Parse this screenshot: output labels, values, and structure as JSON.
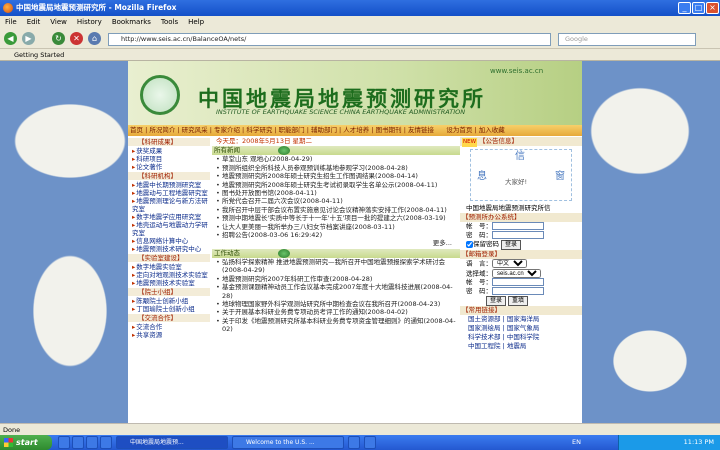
{
  "window": {
    "title": "中国地震局地震预测研究所 - Mozilla Firefox"
  },
  "menu": [
    "File",
    "Edit",
    "View",
    "History",
    "Bookmarks",
    "Tools",
    "Help"
  ],
  "toolbar": {
    "url": "http://www.seis.ac.cn/BalanceOA/nets/",
    "search_placeholder": "Google"
  },
  "bookmarks": {
    "item": "Getting Started"
  },
  "site": {
    "url_text": "www.seis.ac.cn",
    "title_cn": "中国地震局地震预测研究所",
    "title_en": "INSTITUTE OF EARTHQUAKE SCIENCE CHINA EARTHQUAKE ADMINISTRATION",
    "nav": [
      "首页",
      "所况简介",
      "研究风采",
      "专家介绍",
      "科学研究",
      "职能部门",
      "辅助部门",
      "人才培养",
      "图书期刊",
      "友情链接",
      "设为首页",
      "加入收藏"
    ],
    "date": "今天是：2008年5月13日 星期二"
  },
  "sidebar": {
    "sec1": "【科研成果】",
    "list1": [
      "获奖成果",
      "科研项目",
      "论文著作"
    ],
    "sec2": "【科研机构】",
    "list2": [
      "地震中长期预测研究室",
      "地震动与工程地震研究室",
      "地震预测理论与新方法研究室",
      "数字地震学应用研究室",
      "地壳运动与地震动力学研究室",
      "信息网络计算中心",
      "地震预测技术研究中心"
    ],
    "sec3": "【实验室建设】",
    "list3": [
      "数字地震实验室",
      "定向对地观测技术实验室",
      "地震预测技术实验室"
    ],
    "sec4": "【院士小组】",
    "list4": [
      "陈颙院士创新小组",
      "丁国瑜院士创新小组"
    ],
    "sec5": "【交流合作】",
    "list5": [
      "交流合作",
      "共享资源"
    ]
  },
  "news": {
    "header": "所有新闻",
    "items": [
      "草堂山东 观地心(2008-04-29)",
      "预测所组织全所科技人员参观预训练基地参观学习(2008-04-28)",
      "地震预测研究所2008年硕士研究生招生工作图调结果(2008-04-14)",
      "地震预测研究所2008年硕士研究生考试初录取学生名单公示(2008-04-11)",
      "图书处开放图书馆(2008-04-11)",
      "所党代会召开二届六次会议(2008-04-11)",
      "我所召开中层干部会议布置实施意见讨论会议精神落实安排工作(2008-04-11)",
      "预测中期地震长'实质中等长于十一年'十五'项目一批的提建之六(2008-03-19)",
      "让大人更美丽一我所举办三八妇女节档案讲座(2008-03-11)",
      "招聘公告(2008-03-06 16:29:42)"
    ],
    "more": "更多..."
  },
  "work": {
    "header": "工作动态",
    "items": [
      "弘扬科学探索精神 推进地震预测研究—我所召开中国地震预报探索学术研讨会(2008-04-29)",
      "地震预测研究所2007年科研工作审查(2008-04-28)",
      "基金预测课题精神动员工作会议基本完成2007年度十大地震科技进展(2008-04-28)",
      "地球物理国家野外科学观测站研究所中期检查会议在我所召开(2008-04-23)",
      "关于开展基本科研业务费专项动员考评工作的通知(2008-04-02)",
      "关于印发《地震预测研究所基本科研业务费专项资金管理细则》的通知(2008-04-02)"
    ]
  },
  "right": {
    "new_badge": "NEW",
    "notice_header": "【公告信息】",
    "xin": [
      "信",
      "息",
      "窗"
    ],
    "welcome": "大家好!",
    "org": "中国地震局地震预测研究所信",
    "login_header": "【预测所办公系统】",
    "account_label": "帐　号：",
    "password_label": "密　码：",
    "save_label": "保留密码",
    "login_btn": "登录",
    "mail_header": "【邮箱登录】",
    "lang_label": "语　言：",
    "lang_value": "中文",
    "domain_label": "选择域：",
    "domain_value": "seis.ac.cn",
    "reset_btn": "重填",
    "links_header": "【常用链接】",
    "links": [
      "国土资源部 | 国家海洋局",
      "国家测绘局 | 国家气象局",
      "科学技术部 | 中国科学院",
      "中国工程院 | 地震局"
    ]
  },
  "status": {
    "text": "Done"
  },
  "taskbar": {
    "start": "start",
    "tasks": [
      "",
      "",
      "",
      "",
      "中国地震局地震预...",
      "Welcome to the U.S. ...",
      "",
      ""
    ],
    "lang": "EN",
    "clock": "11:13 PM"
  }
}
